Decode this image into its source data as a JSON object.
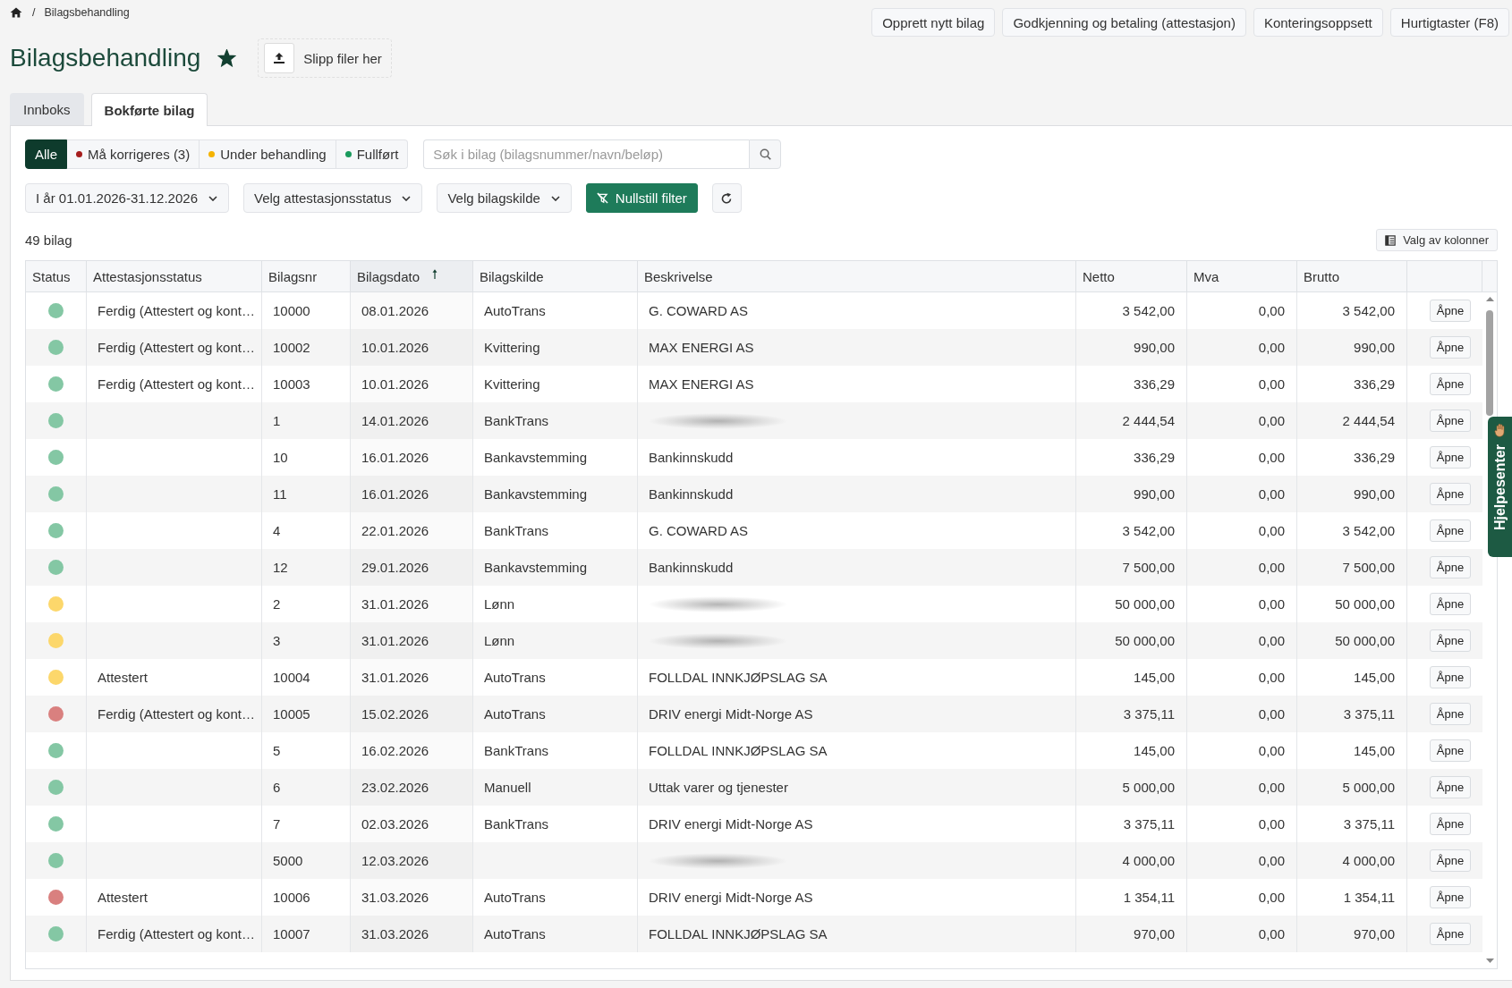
{
  "breadcrumb": {
    "separator": "/",
    "current": "Bilagsbehandling"
  },
  "header": {
    "title": "Bilagsbehandling",
    "favorite": true,
    "drop_zone": "Slipp filer her"
  },
  "actions": [
    "Opprett nytt bilag",
    "Godkjenning og betaling (attestasjon)",
    "Konteringsoppsett",
    "Hurtigtaster (F8)"
  ],
  "tabs": [
    {
      "label": "Innboks",
      "selected": false
    },
    {
      "label": "Bokførte bilag",
      "selected": true
    }
  ],
  "status_filter": [
    {
      "label": "Alle",
      "selected": true
    },
    {
      "label": "Må korrigeres (3)",
      "selected": false,
      "color": "#a51d1d"
    },
    {
      "label": "Under behandling",
      "selected": false,
      "color": "#f5b301"
    },
    {
      "label": "Fullført",
      "selected": false,
      "color": "#1a9a5d"
    }
  ],
  "search": {
    "placeholder": "Søk i bilag (bilagsnummer/navn/beløp)"
  },
  "filters": [
    {
      "kind": "dropdown",
      "label": "I år 01.01.2026-31.12.2026"
    },
    {
      "kind": "dropdown",
      "label": "Velg attestasjonsstatus"
    },
    {
      "kind": "dropdown",
      "label": "Velg bilagskilde"
    },
    {
      "kind": "reset",
      "label": "Nullstill filter"
    },
    {
      "kind": "refresh"
    }
  ],
  "count": "49 bilag",
  "column_chooser": "Valg av kolonner",
  "table": {
    "columns": [
      {
        "label": "Status",
        "sorted": false
      },
      {
        "label": "Attestasjonsstatus",
        "sorted": false
      },
      {
        "label": "Bilagsnr",
        "sorted": false
      },
      {
        "label": "Bilagsdato",
        "sorted": true
      },
      {
        "label": "Bilagskilde",
        "sorted": false
      },
      {
        "label": "Beskrivelse",
        "sorted": false
      },
      {
        "label": "Netto",
        "sorted": false
      },
      {
        "label": "Mva",
        "sorted": false
      },
      {
        "label": "Brutto",
        "sorted": false
      }
    ],
    "rows": [
      {
        "color": "#84c7a4",
        "attestation": "Ferdig (Attestert og kont…",
        "number": "10000",
        "date": "08.01.2026",
        "source": "AutoTrans",
        "description": "G. COWARD AS",
        "blurred": false,
        "net": "3 542,00",
        "vat": "0,00",
        "gross": "3 542,00",
        "action": "Åpne"
      },
      {
        "color": "#84c7a4",
        "attestation": "Ferdig (Attestert og kont…",
        "number": "10002",
        "date": "10.01.2026",
        "source": "Kvittering",
        "description": "MAX ENERGI AS",
        "blurred": false,
        "net": "990,00",
        "vat": "0,00",
        "gross": "990,00",
        "action": "Åpne"
      },
      {
        "color": "#84c7a4",
        "attestation": "Ferdig (Attestert og kont…",
        "number": "10003",
        "date": "10.01.2026",
        "source": "Kvittering",
        "description": "MAX ENERGI AS",
        "blurred": false,
        "net": "336,29",
        "vat": "0,00",
        "gross": "336,29",
        "action": "Åpne"
      },
      {
        "color": "#84c7a4",
        "number": "1",
        "date": "14.01.2026",
        "source": "BankTrans",
        "blurred": true,
        "net": "2 444,54",
        "vat": "0,00",
        "gross": "2 444,54",
        "action": "Åpne"
      },
      {
        "color": "#84c7a4",
        "number": "10",
        "date": "16.01.2026",
        "source": "Bankavstemming",
        "description": "Bankinnskudd",
        "blurred": false,
        "net": "336,29",
        "vat": "0,00",
        "gross": "336,29",
        "action": "Åpne"
      },
      {
        "color": "#84c7a4",
        "number": "11",
        "date": "16.01.2026",
        "source": "Bankavstemming",
        "description": "Bankinnskudd",
        "blurred": false,
        "net": "990,00",
        "vat": "0,00",
        "gross": "990,00",
        "action": "Åpne"
      },
      {
        "color": "#84c7a4",
        "number": "4",
        "date": "22.01.2026",
        "source": "BankTrans",
        "description": "G. COWARD AS",
        "blurred": false,
        "net": "3 542,00",
        "vat": "0,00",
        "gross": "3 542,00",
        "action": "Åpne"
      },
      {
        "color": "#84c7a4",
        "number": "12",
        "date": "29.01.2026",
        "source": "Bankavstemming",
        "description": "Bankinnskudd",
        "blurred": false,
        "net": "7 500,00",
        "vat": "0,00",
        "gross": "7 500,00",
        "action": "Åpne"
      },
      {
        "color": "#fcd76b",
        "number": "2",
        "date": "31.01.2026",
        "source": "Lønn",
        "blurred": true,
        "net": "50 000,00",
        "vat": "0,00",
        "gross": "50 000,00",
        "action": "Åpne"
      },
      {
        "color": "#fcd76b",
        "number": "3",
        "date": "31.01.2026",
        "source": "Lønn",
        "blurred": true,
        "net": "50 000,00",
        "vat": "0,00",
        "gross": "50 000,00",
        "action": "Åpne"
      },
      {
        "color": "#fcd76b",
        "attestation": "Attestert",
        "number": "10004",
        "date": "31.01.2026",
        "source": "AutoTrans",
        "description": "FOLLDAL INNKJØPSLAG SA",
        "blurred": false,
        "net": "145,00",
        "vat": "0,00",
        "gross": "145,00",
        "action": "Åpne"
      },
      {
        "color": "#d9807f",
        "attestation": "Ferdig (Attestert og kont…",
        "number": "10005",
        "date": "15.02.2026",
        "source": "AutoTrans",
        "description": "DRIV energi Midt-Norge AS",
        "blurred": false,
        "net": "3 375,11",
        "vat": "0,00",
        "gross": "3 375,11",
        "action": "Åpne"
      },
      {
        "color": "#84c7a4",
        "number": "5",
        "date": "16.02.2026",
        "source": "BankTrans",
        "description": "FOLLDAL INNKJØPSLAG SA",
        "blurred": false,
        "net": "145,00",
        "vat": "0,00",
        "gross": "145,00",
        "action": "Åpne"
      },
      {
        "color": "#84c7a4",
        "number": "6",
        "date": "23.02.2026",
        "source": "Manuell",
        "description": "Uttak varer og tjenester",
        "blurred": false,
        "net": "5 000,00",
        "vat": "0,00",
        "gross": "5 000,00",
        "action": "Åpne"
      },
      {
        "color": "#84c7a4",
        "number": "7",
        "date": "02.03.2026",
        "source": "BankTrans",
        "description": "DRIV energi Midt-Norge AS",
        "blurred": false,
        "net": "3 375,11",
        "vat": "0,00",
        "gross": "3 375,11",
        "action": "Åpne"
      },
      {
        "color": "#84c7a4",
        "number": "5000",
        "date": "12.03.2026",
        "blurred": true,
        "net": "4 000,00",
        "vat": "0,00",
        "gross": "4 000,00",
        "action": "Åpne"
      },
      {
        "color": "#d9807f",
        "attestation": "Attestert",
        "number": "10006",
        "date": "31.03.2026",
        "source": "AutoTrans",
        "description": "DRIV energi Midt-Norge AS",
        "blurred": false,
        "net": "1 354,11",
        "vat": "0,00",
        "gross": "1 354,11",
        "action": "Åpne"
      },
      {
        "color": "#84c7a4",
        "attestation": "Ferdig (Attestert og kont…",
        "number": "10007",
        "date": "31.03.2026",
        "source": "AutoTrans",
        "description": "FOLLDAL INNKJØPSLAG SA",
        "blurred": false,
        "net": "970,00",
        "vat": "0,00",
        "gross": "970,00",
        "action": "Åpne"
      }
    ]
  },
  "help_tab": "Hjelpesenter"
}
